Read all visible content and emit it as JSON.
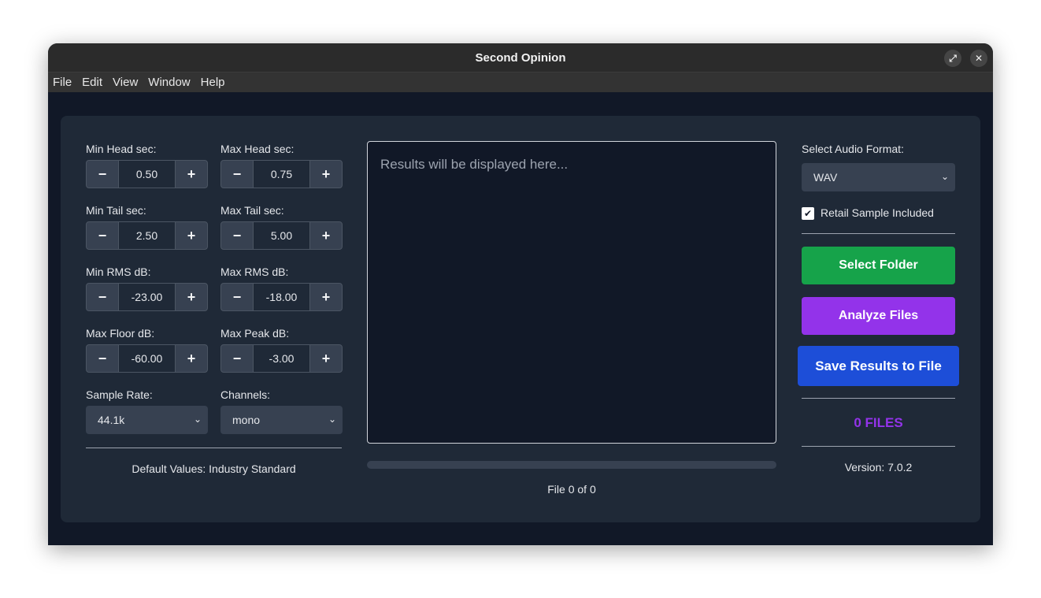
{
  "window": {
    "title": "Second Opinion",
    "controls": {
      "maximize_icon": "maximize-icon",
      "close_icon": "close-icon"
    }
  },
  "menu": [
    "File",
    "Edit",
    "View",
    "Window",
    "Help"
  ],
  "params": {
    "min_head": {
      "label": "Min Head sec:",
      "value": "0.50"
    },
    "max_head": {
      "label": "Max Head sec:",
      "value": "0.75"
    },
    "min_tail": {
      "label": "Min Tail sec:",
      "value": "2.50"
    },
    "max_tail": {
      "label": "Max Tail sec:",
      "value": "5.00"
    },
    "min_rms": {
      "label": "Min RMS dB:",
      "value": "-23.00"
    },
    "max_rms": {
      "label": "Max RMS dB:",
      "value": "-18.00"
    },
    "max_floor": {
      "label": "Max Floor dB:",
      "value": "-60.00"
    },
    "max_peak": {
      "label": "Max Peak dB:",
      "value": "-3.00"
    }
  },
  "stepper": {
    "minus": "−",
    "plus": "+"
  },
  "sample_rate": {
    "label": "Sample Rate:",
    "value": "44.1k"
  },
  "channels": {
    "label": "Channels:",
    "value": "mono"
  },
  "defaults_text": "Default Values: Industry Standard",
  "results": {
    "placeholder": "Results will be displayed here...",
    "progress": 0,
    "file_counter": "File 0 of 0"
  },
  "format": {
    "label": "Select Audio Format:",
    "value": "WAV"
  },
  "retail": {
    "label": "Retail Sample Included",
    "checked": true
  },
  "buttons": {
    "select_folder": "Select Folder",
    "analyze": "Analyze Files",
    "save": "Save Results to File"
  },
  "files_count": "0 FILES",
  "version": "Version: 7.0.2",
  "colors": {
    "green": "#16a34a",
    "purple": "#9333ea",
    "blue": "#1d4ed8",
    "files_count": "#9333ea"
  }
}
